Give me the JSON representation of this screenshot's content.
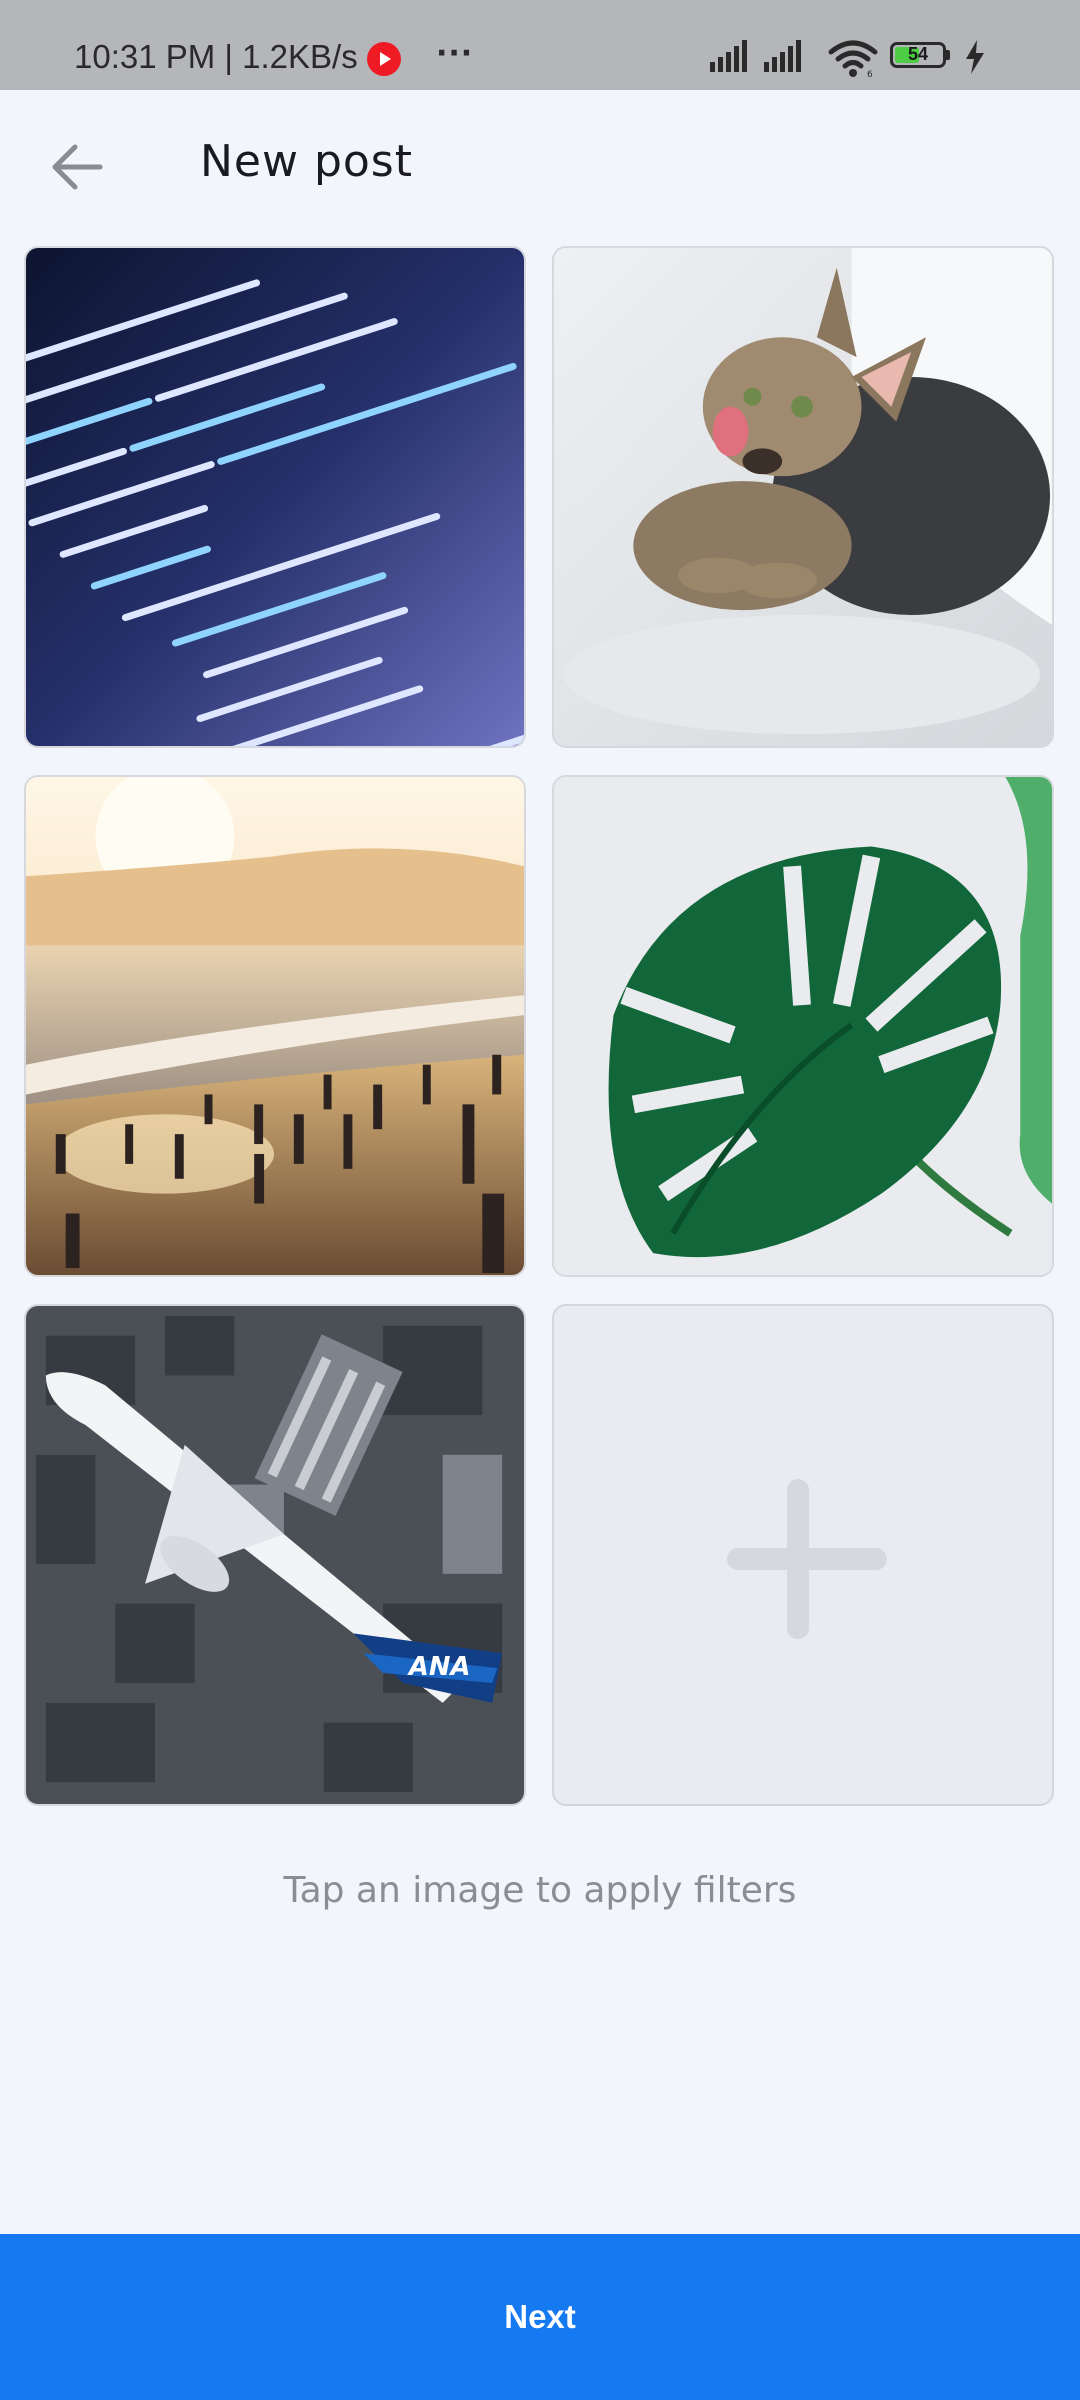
{
  "status_bar": {
    "time_speed": "10:31 PM | 1.2KB/s",
    "more": "···",
    "battery_level": "54",
    "battery_fraction": 0.54,
    "icons": [
      "youtube-music-icon",
      "more-icon",
      "signal-icon",
      "signal-icon",
      "wifi-icon",
      "battery-icon",
      "charging-icon"
    ]
  },
  "header": {
    "title": "New post",
    "back_icon": "arrow-left-icon"
  },
  "grid": {
    "images": [
      "code-screenshot",
      "cat",
      "beach-sunset",
      "monstera-leaf",
      "ana-airplane"
    ],
    "add_icon": "plus-icon"
  },
  "hint": "Tap an image to apply filters",
  "footer": {
    "next_label": "Next"
  },
  "colors": {
    "background": "#f2f5fc",
    "status_bar": "#b4b6ba",
    "accent": "#1579f2",
    "hint_text": "#8b8d92"
  }
}
